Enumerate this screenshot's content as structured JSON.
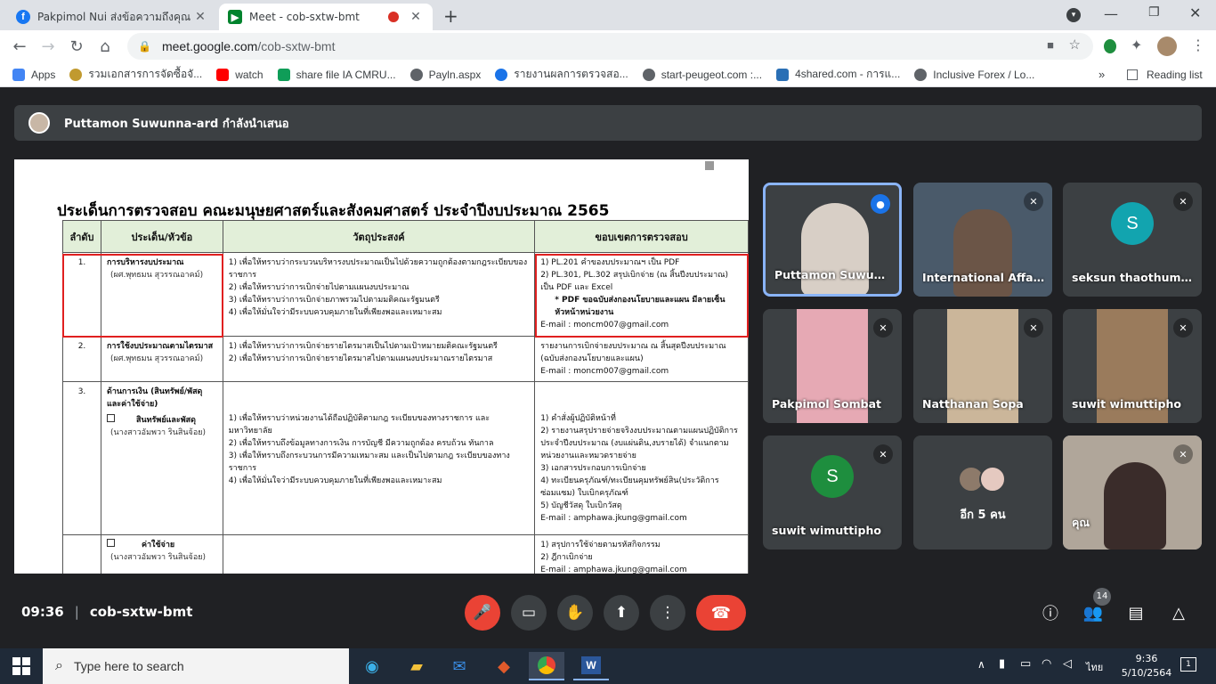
{
  "browser": {
    "tabs": [
      {
        "title": "Pakpimol Nui ส่งข้อความถึงคุณ",
        "icon": "facebook-icon",
        "color": "#1877f2"
      },
      {
        "title": "Meet - cob-sxtw-bmt",
        "icon": "google-meet-icon",
        "color": "#00832d"
      }
    ],
    "url_host": "meet.google.com",
    "url_path": "/cob-sxtw-bmt",
    "bookmarks": [
      {
        "label": "Apps",
        "color": "#4285f4"
      },
      {
        "label": "รวมเอกสารการจัดซื้อจั...",
        "color": "#c19a2f"
      },
      {
        "label": "watch",
        "color": "#ff0000"
      },
      {
        "label": "share file IA CMRU...",
        "color": "#0f9d58"
      },
      {
        "label": "Payln.aspx",
        "color": "#5f6368"
      },
      {
        "label": "รายงานผลการตรวจสอ...",
        "color": "#1a73e8"
      },
      {
        "label": "start-peugeot.com :...",
        "color": "#5f6368"
      },
      {
        "label": "4shared.com - การแ...",
        "color": "#2a6fb5"
      },
      {
        "label": "Inclusive Forex / Lo...",
        "color": "#5f6368"
      }
    ],
    "more_bookmarks": "»",
    "reading_list": "Reading list"
  },
  "presenter": {
    "text": "Puttamon Suwunna-ard กำลังนำเสนอ"
  },
  "slide": {
    "title": "ประเด็นการตรวจสอบ คณะมนุษยศาสตร์และสังคมศาสตร์  ประจำปีงบประมาณ 2565",
    "headers": [
      "ลำดับ",
      "ประเด็น/หัวข้อ",
      "วัตถุประสงค์",
      "ขอบเขตการตรวจสอบ"
    ],
    "rows": [
      {
        "no": "1.",
        "topic": "การบริหารงบประมาณ",
        "person": "(ผศ.พุทธมน สุวรรณอาคม์)",
        "objectives": [
          "1)   เพื่อให้ทราบว่ากระบวนบริหารงบประมาณเป็นไปด้วยความถูกต้องตามกฎระเบียบของราชการ",
          "2)   เพื่อให้ทราบว่าการเบิกจ่ายไปตามแผนงบประมาณ",
          "3)   เพื่อให้ทราบว่าการเบิกจ่ายภาพรวมไปตามมติคณะรัฐมนตรี",
          "4)   เพื่อให้มั่นใจว่ามีระบบควบคุมภายในที่เพียงพอและเหมาะสม"
        ],
        "scope": [
          "1)   PL.201 คำของบประมาณฯ  เป็น PDF",
          "2)   PL.301, PL.302 สรุปเบิกจ่าย (ณ สิ้นปีงบประมาณ) เป็น PDF และ Excel",
          "* PDF ขอฉบับส่งกองนโยบายและแผน มีลายเซ็นหัวหน้าหน่วยงาน",
          "E-mail : moncm007@gmail.com"
        ]
      },
      {
        "no": "2.",
        "topic": "การใช้งบประมาณตามไตรมาส",
        "person": "(ผศ.พุทธมน สุวรรณอาคม์)",
        "objectives": [
          "1)   เพื่อให้ทราบว่าการเบิกจ่ายรายไตรมาสเป็นไปตามเป้าหมายมติคณะรัฐมนตรี",
          "2)   เพื่อให้ทราบว่าการเบิกจ่ายรายไตรมาสไปตามแผนงบประมาณรายไตรมาส"
        ],
        "scope": [
          "รายงานการเบิกจ่ายงบประมาณ ณ สิ้นสุดปีงบประมาณ (ฉบับส่งกองนโยบายและแผน)",
          "E-mail : moncm007@gmail.com"
        ]
      },
      {
        "no": "3.",
        "topic": "ด้านการเงิน (สินทรัพย์/พัสดุ และค่าใช้จ่าย)",
        "sub": "สินทรัพย์และพัสดุ",
        "person": "(นางสาวอัมพวา รินสินจ้อย)",
        "objectives": [
          "1)   เพื่อให้ทราบว่าหน่วยงานได้ถือปฏิบัติตามกฎ ระเบียบของทางราชการ และมหาวิทยาลัย",
          "2)   เพื่อให้ทราบถึงข้อมูลทางการเงิน การบัญชี มีความถูกต้อง ครบถ้วน ทันกาล",
          "3)   เพื่อให้ทราบถึงกระบวนการมีความเหมาะสม และเป็นไปตามกฎ ระเบียบของทางราชการ",
          "4)   เพื่อให้มั่นใจว่ามีระบบควบคุมภายในที่เพียงพอและเหมาะสม"
        ],
        "scope": [
          "1)   คำสั่งผู้ปฏิบัติหน้าที่",
          "2)   รายงานสรุปรายจ่ายจริงงบประมาณตามแผนปฏิบัติการประจำปีงบประมาณ (งบแผ่นดิน,งบรายได้) จำแนกตามหน่วยงานและหมวดรายจ่าย",
          "3)   เอกสารประกอบการเบิกจ่าย",
          "4)   ทะเบียนครุภัณฑ์/ทะเบียนคุมทรัพย์สิน(ประวัติการซ่อมแซม) ใบเบิกครุภัณฑ์",
          "5)   บัญชีวัสดุ ใบเบิกวัสดุ",
          "E-mail : amphawa.jkung@gmail.com"
        ]
      },
      {
        "no": "",
        "sub": "ค่าใช้จ่าย",
        "person": "(นางสาวอัมพวา รินสินจ้อย)",
        "scope": [
          "1)   สรุปการใช้จ่ายตามรหัสกิจกรรม",
          "2)   ฎีกาเบิกจ่าย",
          "E-mail : amphawa.jkung@gmail.com"
        ]
      }
    ]
  },
  "participants": [
    {
      "name": "Puttamon Suwunna-ard",
      "mic": "speaking"
    },
    {
      "name": "International Affairs",
      "mic": "muted"
    },
    {
      "name": "seksun thaothumma",
      "mic": "muted",
      "initial": "S",
      "color": "#12a4af"
    },
    {
      "name": "Pakpimol Sombat",
      "mic": "muted"
    },
    {
      "name": "Natthanan Sopa",
      "mic": "muted"
    },
    {
      "name": "suwit wimuttipho",
      "mic": "muted"
    },
    {
      "name": "suwit wimuttipho",
      "mic": "muted",
      "initial": "S",
      "color": "#1e8e3e"
    },
    {
      "name": "อีก 5 คน"
    },
    {
      "name": "คุณ",
      "mic": "muted"
    }
  ],
  "meet_bar": {
    "time": "09:36",
    "code": "cob-sxtw-bmt",
    "participant_count": "14"
  },
  "taskbar": {
    "search_placeholder": "Type here to search",
    "lang": "ไทย",
    "clock_time": "9:36",
    "clock_date": "5/10/2564",
    "notif_count": "1"
  }
}
